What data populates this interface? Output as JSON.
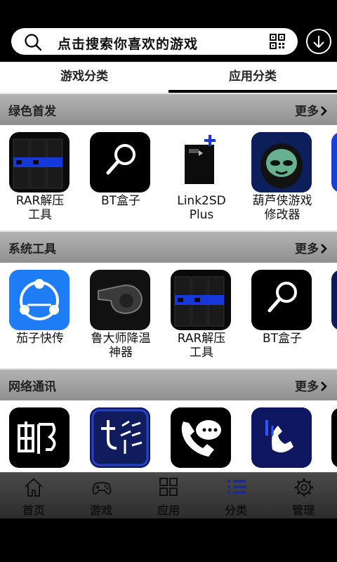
{
  "search": {
    "placeholder": "点击搜索你喜欢的游戏",
    "icon": "search-icon",
    "qr_icon": "qr-code-icon",
    "download_icon": "download-icon"
  },
  "tabs": [
    {
      "label": "游戏分类",
      "selected": false
    },
    {
      "label": "应用分类",
      "selected": true
    }
  ],
  "sections": [
    {
      "title": "绿色首发",
      "more": "更多",
      "apps": [
        {
          "name_l1": "RAR解压",
          "name_l2": "工具",
          "icon": "rar-books-icon"
        },
        {
          "name_l1": "BT盒子",
          "name_l2": "",
          "icon": "magnifier-icon"
        },
        {
          "name_l1": "Link2SD",
          "name_l2": "Plus",
          "icon": "link2sd-icon"
        },
        {
          "name_l1": "葫芦侠游戏",
          "name_l2": "修改器",
          "icon": "alien-icon"
        }
      ]
    },
    {
      "title": "系统工具",
      "more": "更多",
      "apps": [
        {
          "name_l1": "茄子快传",
          "name_l2": "",
          "icon": "share-icon"
        },
        {
          "name_l1": "鲁大师降温",
          "name_l2": "神器",
          "icon": "whistle-icon"
        },
        {
          "name_l1": "RAR解压",
          "name_l2": "工具",
          "icon": "rar-books-icon"
        },
        {
          "name_l1": "BT盒子",
          "name_l2": "",
          "icon": "magnifier-icon"
        }
      ]
    },
    {
      "title": "网络通讯",
      "more": "更多",
      "apps": [
        {
          "name_l1": "",
          "name_l2": "",
          "icon": "mail-character-icon"
        },
        {
          "name_l1": "",
          "name_l2": "",
          "icon": "qicai-icon"
        },
        {
          "name_l1": "",
          "name_l2": "",
          "icon": "phone-chat-icon"
        },
        {
          "name_l1": "",
          "name_l2": "",
          "icon": "phone-call-icon"
        }
      ]
    }
  ],
  "bottom_nav": [
    {
      "label": "首页",
      "icon": "home-icon"
    },
    {
      "label": "游戏",
      "icon": "gamepad-icon"
    },
    {
      "label": "应用",
      "icon": "grid-icon"
    },
    {
      "label": "分类",
      "icon": "list-icon"
    },
    {
      "label": "管理",
      "icon": "gear-icon"
    }
  ],
  "colors": {
    "section_header": "#a0a0a0",
    "icon_blue": "#1d4ed8",
    "nav_bg": "#3a3a3a"
  }
}
